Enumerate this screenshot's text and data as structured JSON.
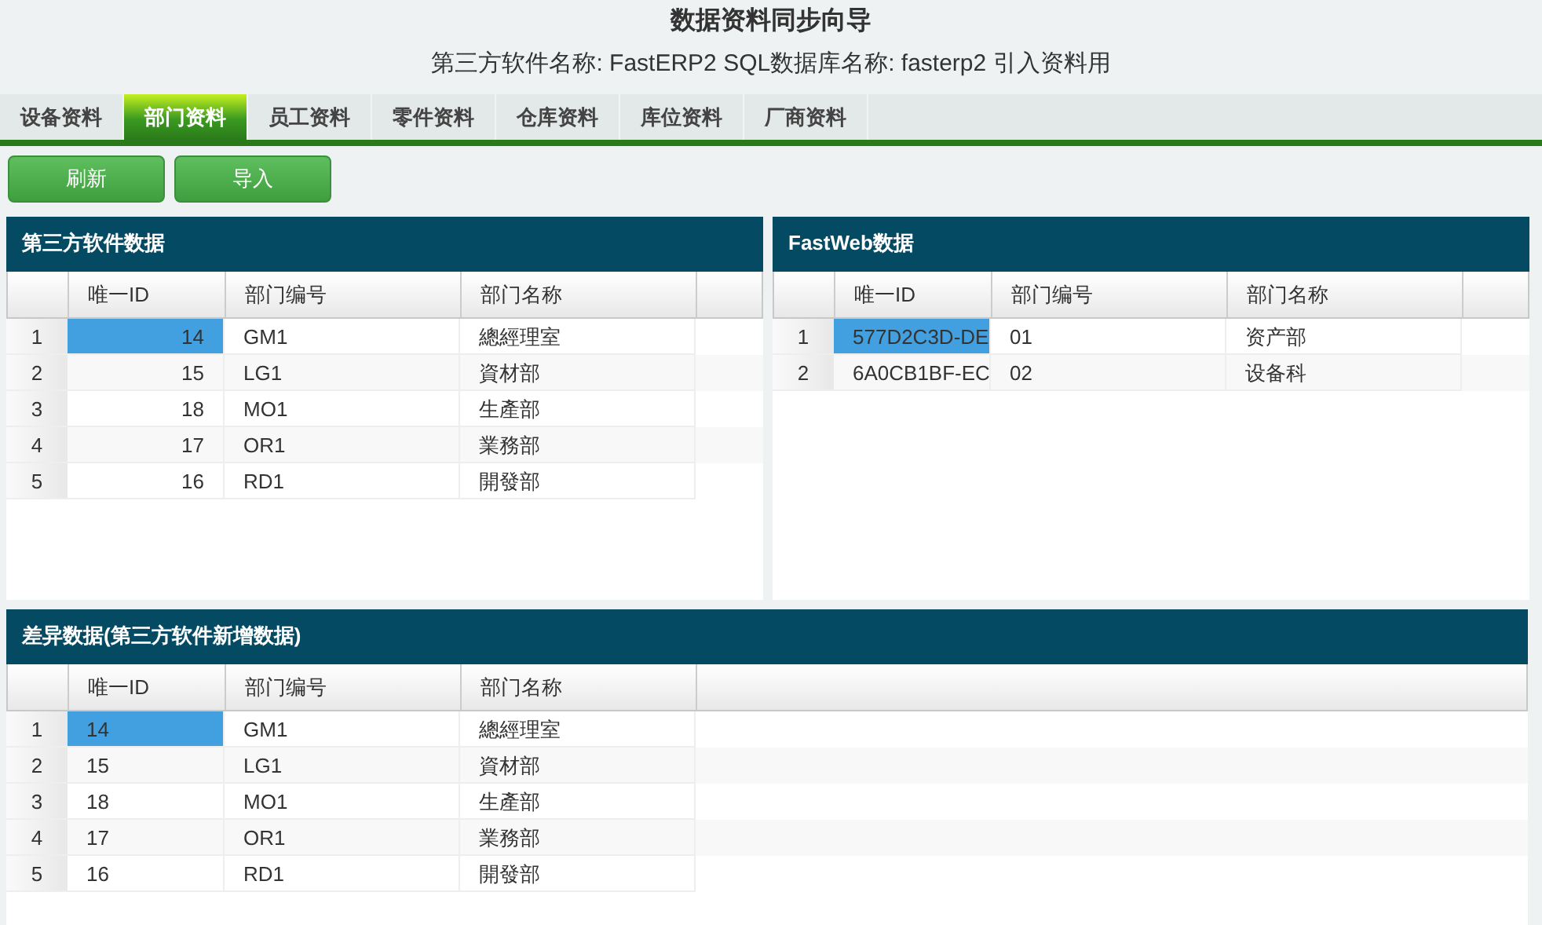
{
  "title": "数据资料同步向导",
  "subtitle": "第三方软件名称: FastERP2 SQL数据库名称: fasterp2 引入资料用",
  "tabs": [
    {
      "label": "设备资料",
      "selected": false
    },
    {
      "label": "部门资料",
      "selected": true
    },
    {
      "label": "员工资料",
      "selected": false
    },
    {
      "label": "零件资料",
      "selected": false
    },
    {
      "label": "仓库资料",
      "selected": false
    },
    {
      "label": "库位资料",
      "selected": false
    },
    {
      "label": "厂商资料",
      "selected": false
    }
  ],
  "buttons": [
    "刷新",
    "导入"
  ],
  "panels": [
    {
      "title": "第三方软件数据",
      "columns": [
        "唯一ID",
        "部门编号",
        "部门名称"
      ],
      "rows": [
        {
          "num": "1",
          "cells": [
            "14",
            "GM1",
            "總經理室"
          ],
          "selected": true
        },
        {
          "num": "2",
          "cells": [
            "15",
            "LG1",
            "資材部"
          ],
          "selected": false
        },
        {
          "num": "3",
          "cells": [
            "18",
            "MO1",
            "生產部"
          ],
          "selected": false
        },
        {
          "num": "4",
          "cells": [
            "17",
            "OR1",
            "業務部"
          ],
          "selected": false
        },
        {
          "num": "5",
          "cells": [
            "16",
            "RD1",
            "開發部"
          ],
          "selected": false
        }
      ]
    },
    {
      "title": "FastWeb数据",
      "columns": [
        "唯一ID",
        "部门编号",
        "部门名称"
      ],
      "rows": [
        {
          "num": "1",
          "cells": [
            "577D2C3D-DE",
            "01",
            "资产部"
          ],
          "selected": true
        },
        {
          "num": "2",
          "cells": [
            "6A0CB1BF-EC",
            "02",
            "设备科"
          ],
          "selected": false
        }
      ]
    },
    {
      "title": "差异数据(第三方软件新增数据)",
      "columns": [
        "唯一ID",
        "部门编号",
        "部门名称"
      ],
      "rows": [
        {
          "num": "1",
          "cells": [
            "14",
            "GM1",
            "總經理室"
          ],
          "selected": true
        },
        {
          "num": "2",
          "cells": [
            "15",
            "LG1",
            "資材部"
          ],
          "selected": false
        },
        {
          "num": "3",
          "cells": [
            "18",
            "MO1",
            "生產部"
          ],
          "selected": false
        },
        {
          "num": "4",
          "cells": [
            "17",
            "OR1",
            "業務部"
          ],
          "selected": false
        },
        {
          "num": "5",
          "cells": [
            "16",
            "RD1",
            "開發部"
          ],
          "selected": false
        }
      ]
    }
  ]
}
